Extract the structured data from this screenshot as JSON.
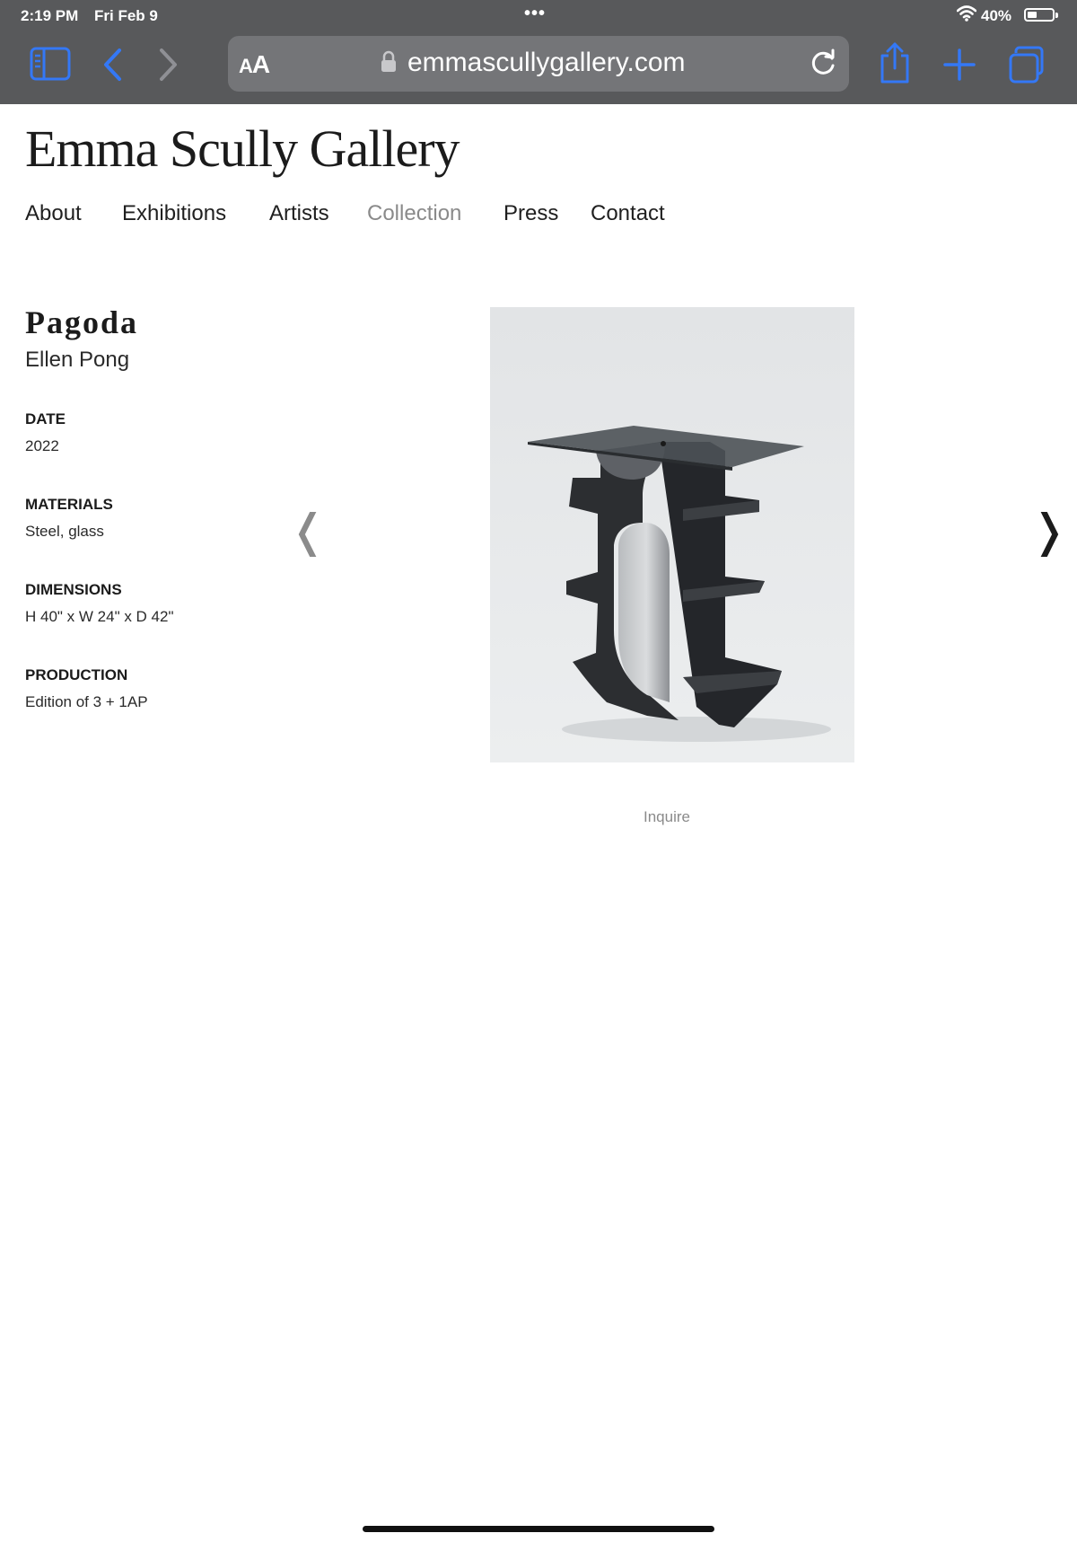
{
  "status_bar": {
    "time": "2:19 PM",
    "date": "Fri Feb 9",
    "battery_percent": "40%",
    "battery_level": 0.4
  },
  "browser": {
    "reader_label": "AA",
    "url": "emmascullygallery.com",
    "accent_color": "#3478f6",
    "icons": [
      "sidebar-icon",
      "back-icon",
      "forward-icon",
      "lock-icon",
      "reload-icon",
      "share-icon",
      "new-tab-icon",
      "tabs-icon"
    ]
  },
  "site": {
    "title": "Emma Scully Gallery",
    "nav": [
      "About",
      "Exhibitions",
      "Artists",
      "Collection",
      "Press",
      "Contact"
    ],
    "active_nav": "Collection"
  },
  "artwork": {
    "title": "Pagoda",
    "artist": "Ellen Pong",
    "date_label": "DATE",
    "date": "2022",
    "materials_label": "MATERIALS",
    "materials": "Steel, glass",
    "dimensions_label": "DIMENSIONS",
    "dimensions": "H 40\" x W 24\" x D 42\"",
    "production_label": "PRODUCTION",
    "production": "Edition of 3 + 1AP",
    "inquire_label": "Inquire"
  },
  "carousel": {
    "prev_glyph": "❬",
    "next_glyph": "❭"
  }
}
